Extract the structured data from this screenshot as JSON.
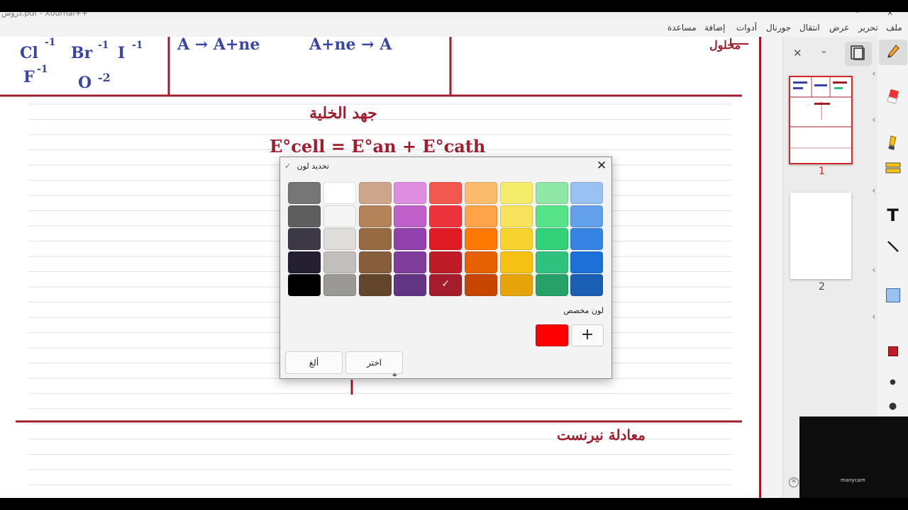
{
  "window": {
    "title": "دروس.pdf - Xournal++",
    "minimize_glyph": "–",
    "close_glyph": "✕"
  },
  "menubar": {
    "items": [
      "ملف",
      "تحرير",
      "عرض",
      "انتقال",
      "جورنال",
      "أدوات",
      "إضافة",
      "مساعدة"
    ]
  },
  "canvas": {
    "handwriting": {
      "ions_row1": [
        "Cl",
        "-1",
        "Br",
        "-1",
        "I",
        "-1"
      ],
      "ions_row2": [
        "F",
        "-1",
        "O",
        "-2"
      ],
      "reaction_1": "A → A+ne",
      "reaction_2": "A+ne → A",
      "red_top_right": "محلول",
      "red_title": "جهد الخلية",
      "equation": "E°cell = E°an + E°cath",
      "red_bottom": "معادلة نيرنست"
    },
    "colors": {
      "ink_red": "#a11d2c",
      "ink_blue": "#3a46a3",
      "ruled_line": "#dde2ef"
    }
  },
  "sidebar": {
    "close_glyph": "✕",
    "chevron_glyph": "⌄",
    "pages": [
      {
        "number": "1",
        "selected": true
      },
      {
        "number": "2",
        "selected": false
      }
    ]
  },
  "toolbar": {
    "tools": [
      "pen-tool",
      "eraser-tool",
      "highlighter-tool",
      "select-tool",
      "text-tool",
      "line-tool",
      "shape-tool",
      "color-tool",
      "size-small",
      "size-medium"
    ]
  },
  "dialog": {
    "title": "تحديد لون",
    "close_glyph": "✕",
    "custom_label": "لون مخصص",
    "choose_label": "اختر",
    "cancel_label": "ألغ",
    "add_glyph": "+",
    "custom_color": "#ff0000",
    "check_glyph": "✓",
    "selected_index": [
      4,
      4
    ],
    "palette": [
      [
        "#767676",
        "#ffffff",
        "#cda58a",
        "#de8de0",
        "#f3584e",
        "#fdbc6d",
        "#f5ec6a",
        "#8fe8a6",
        "#99c1f1"
      ],
      [
        "#5e5e5f",
        "#f5f5f5",
        "#b5835a",
        "#c061cb",
        "#ed333b",
        "#ffa348",
        "#f8e45c",
        "#57e389",
        "#62a0ea"
      ],
      [
        "#3d3846",
        "#deddda",
        "#986a44",
        "#9141ac",
        "#e01b24",
        "#ff7800",
        "#f6d32d",
        "#33d17a",
        "#3584e4"
      ],
      [
        "#241f31",
        "#c0bfbc",
        "#865e3c",
        "#813d9c",
        "#c01c28",
        "#e66100",
        "#f5c211",
        "#2ec27e",
        "#1c71d8"
      ],
      [
        "#000000",
        "#9a9996",
        "#63452c",
        "#613583",
        "#a51d2d",
        "#c64600",
        "#e5a50a",
        "#26a269",
        "#1a5fb4"
      ]
    ]
  },
  "webcam": {
    "label": "manycam"
  }
}
